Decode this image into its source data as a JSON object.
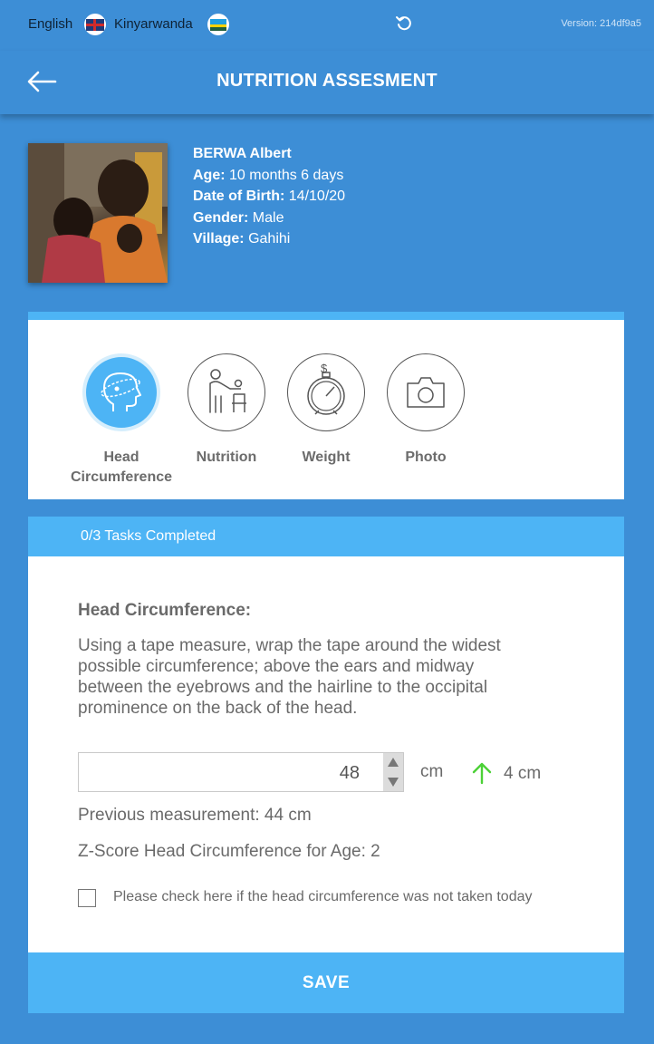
{
  "topbar": {
    "lang_english": "English",
    "lang_kinyarwanda": "Kinyarwanda",
    "version": "Version: 214df9a5"
  },
  "header": {
    "title": "NUTRITION ASSESMENT"
  },
  "profile": {
    "name": "BERWA Albert",
    "age_label": "Age:",
    "age_value": "10 months 6 days",
    "dob_label": "Date of Birth:",
    "dob_value": "14/10/20",
    "gender_label": "Gender:",
    "gender_value": "Male",
    "village_label": "Village:",
    "village_value": "Gahihi"
  },
  "tasks": [
    {
      "label": "Head Circumference",
      "icon": "head-circumference-icon",
      "active": true
    },
    {
      "label": "Nutrition",
      "icon": "nutrition-icon",
      "active": false
    },
    {
      "label": "Weight",
      "icon": "weight-scale-icon",
      "active": false
    },
    {
      "label": "Photo",
      "icon": "camera-icon",
      "active": false
    }
  ],
  "progress": {
    "text": "0/3 Tasks Completed"
  },
  "form": {
    "title": "Head Circumference:",
    "instructions": "Using a tape measure, wrap the tape around the widest possible circumference; above the ears and midway between the eyebrows and the hairline to the occipital prominence on the back of the head.",
    "value": "48",
    "unit": "cm",
    "delta": "4 cm",
    "previous": "Previous measurement: 44 cm",
    "zscore": "Z-Score Head Circumference for Age: 2",
    "not_taken_label": "Please check here if the head circumference was not taken today"
  },
  "save_label": "SAVE",
  "colors": {
    "background": "#3d8ed6",
    "accent": "#4db4f5",
    "increase_arrow": "#4cd137"
  }
}
